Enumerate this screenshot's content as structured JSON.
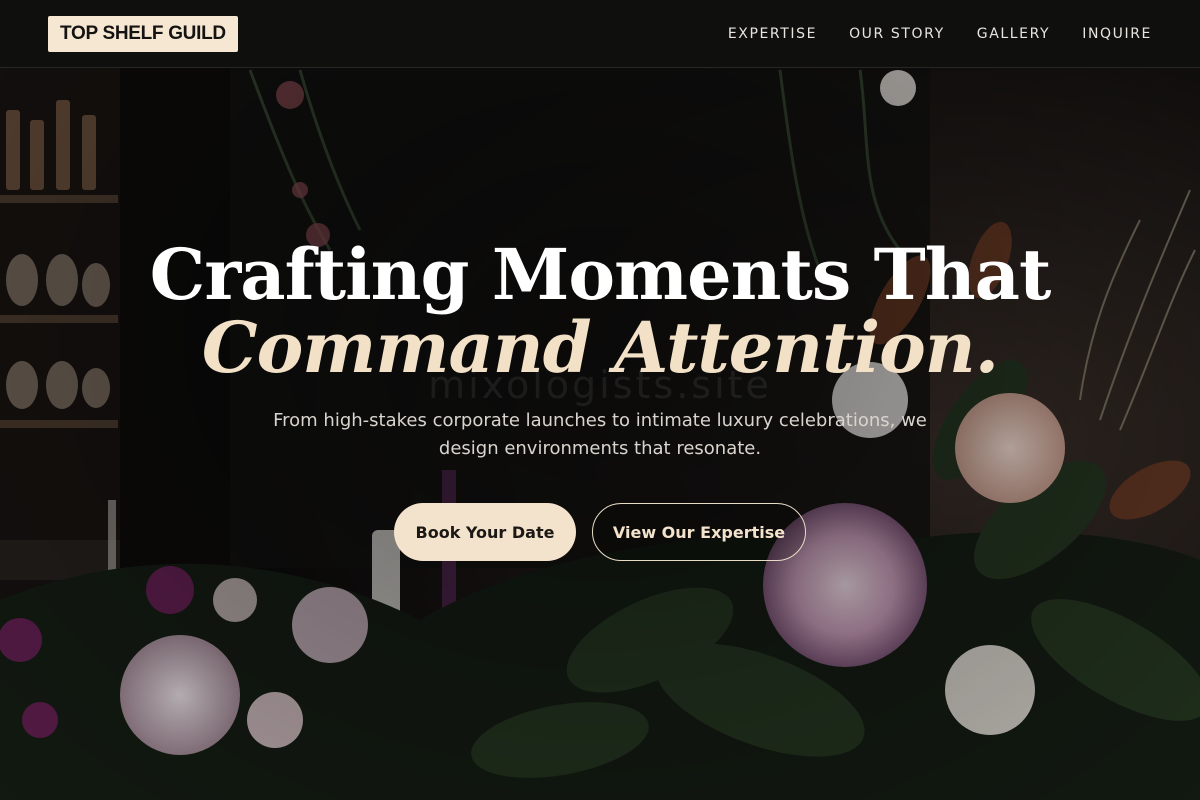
{
  "brand": {
    "name": "TOP SHELF GUILD"
  },
  "nav": {
    "items": [
      {
        "label": "EXPERTISE"
      },
      {
        "label": "OUR STORY"
      },
      {
        "label": "GALLERY"
      },
      {
        "label": "INQUIRE"
      }
    ]
  },
  "hero": {
    "title_line1": "Crafting Moments That",
    "title_line2": "Command Attention.",
    "watermark": "mixologists.site",
    "subtitle": "From high-stakes corporate launches to intimate luxury celebrations, we design environments that resonate.",
    "primary_cta": "Book Your Date",
    "secondary_cta": "View Our Expertise"
  },
  "colors": {
    "accent_cream": "#f4e3cc",
    "navbar_bg": "#100f0e",
    "text_light": "#e9e4de"
  }
}
